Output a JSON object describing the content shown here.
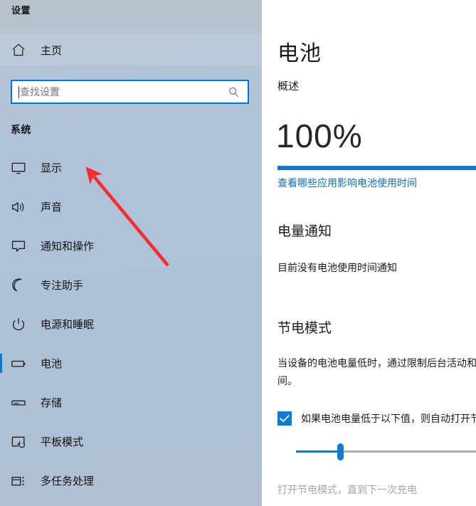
{
  "window": {
    "title": "设置"
  },
  "sidebar": {
    "home": {
      "label": "主页",
      "icon": "home-icon"
    },
    "search": {
      "placeholder": "查找设置",
      "value": "",
      "icon": "search-icon"
    },
    "group_heading": "系统",
    "items": [
      {
        "label": "显示",
        "icon": "monitor-icon",
        "selected": false
      },
      {
        "label": "声音",
        "icon": "speaker-icon",
        "selected": false
      },
      {
        "label": "通知和操作",
        "icon": "chat-bubble-icon",
        "selected": false
      },
      {
        "label": "专注助手",
        "icon": "moon-icon",
        "selected": false
      },
      {
        "label": "电源和睡眠",
        "icon": "power-icon",
        "selected": false
      },
      {
        "label": "电池",
        "icon": "battery-icon",
        "selected": true
      },
      {
        "label": "存储",
        "icon": "storage-icon",
        "selected": false
      },
      {
        "label": "平板模式",
        "icon": "tablet-icon",
        "selected": false
      },
      {
        "label": "多任务处理",
        "icon": "multitask-icon",
        "selected": false
      }
    ]
  },
  "main": {
    "page_title": "电池",
    "overview_heading": "概述",
    "battery_percent_label": "100%",
    "battery_percent_value": 100,
    "battery_apps_link": "查看哪些应用影响电池使用时间",
    "notification_heading": "电量通知",
    "notification_text": "目前没有电池使用时间通知",
    "saver_heading": "节电模式",
    "saver_description": "当设备的电池电量低时，通过限制后台活动和推送通知来延长电池使用时间。",
    "saver_checkbox_label": "如果电池电量低于以下值，则自动打开节电模式：",
    "saver_checkbox_checked": true,
    "saver_slider_value": 20,
    "saver_footnote": "打开节电模式，直到下一次充电"
  },
  "annotation": {
    "arrow_color": "#f82c2c",
    "arrow_target": "显示"
  },
  "colors": {
    "accent": "#0b7bd4",
    "link": "#0a6cc4",
    "sidebar_top": "#b9c4cf",
    "sidebar_bottom": "#b0c0d2",
    "title_band": "#b8c2cc",
    "selection_bar": "#0a7ad1"
  }
}
